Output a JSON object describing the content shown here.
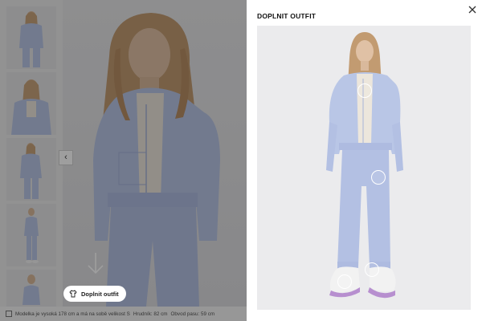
{
  "gallery": {
    "prev_arrow": "‹",
    "complete_outfit_button": "Doplnit outfit",
    "model_info": "Modelka je vysoká 178 cm a má na sobě velikost S",
    "chest": "Hrudník: 82 cm",
    "waist": "Obvod pasu: 59 cm"
  },
  "panel": {
    "title": "DOPLNIT OUTFIT",
    "close_icon": "close-icon"
  },
  "colors": {
    "garment": "#b9c6e6",
    "overlay": "rgba(0,0,0,0.38)",
    "panel_background": "#ffffff"
  }
}
